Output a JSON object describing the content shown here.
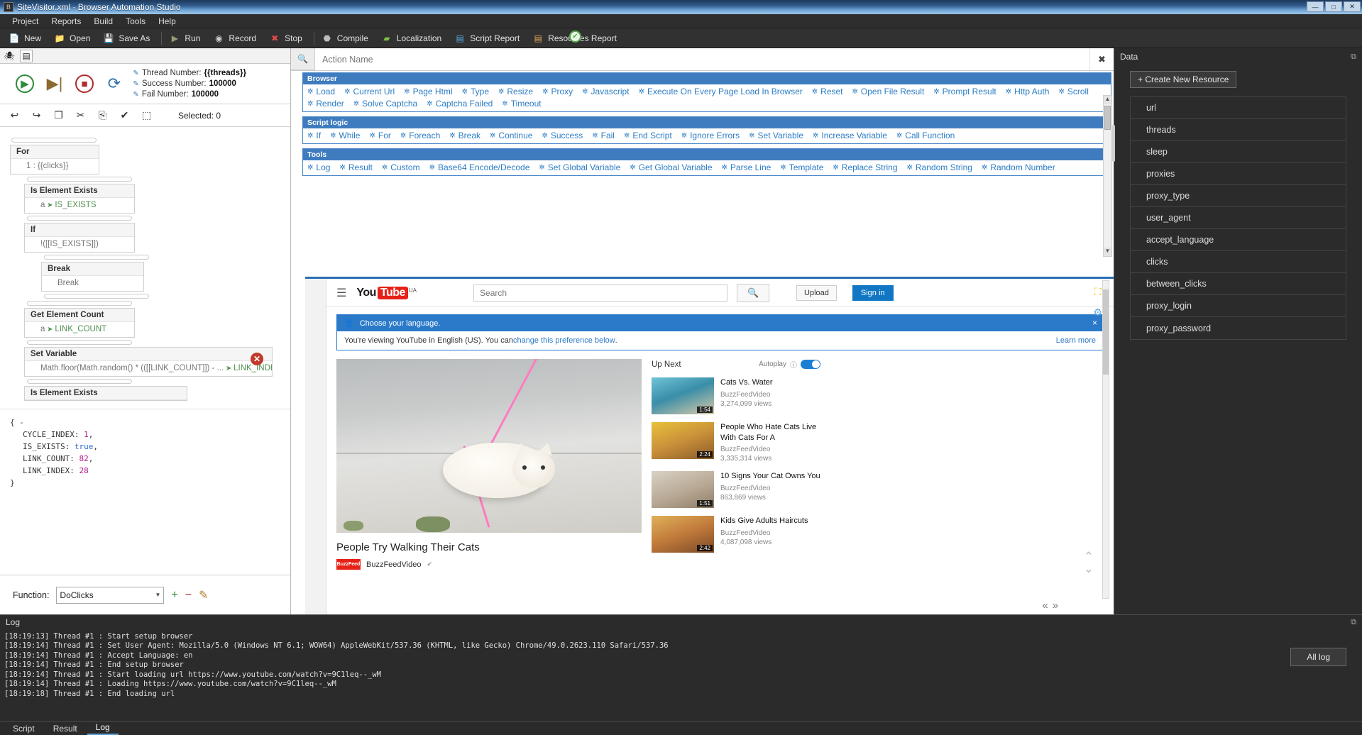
{
  "titlebar": {
    "title": "SiteVisitor.xml - Browser Automation Studio",
    "icon": "app-icon",
    "minimize": "—",
    "maximize": "□",
    "close": "✕"
  },
  "menu": {
    "items": [
      "Project",
      "Reports",
      "Build",
      "Tools",
      "Help"
    ]
  },
  "toolbar": {
    "items": [
      {
        "label": "New",
        "icon": "new-file-icon"
      },
      {
        "label": "Open",
        "icon": "open-folder-icon"
      },
      {
        "label": "Save As",
        "icon": "save-icon"
      },
      {
        "label": "Run",
        "icon": "play-icon"
      },
      {
        "label": "Record",
        "icon": "record-icon"
      },
      {
        "label": "Stop",
        "icon": "stop-icon"
      },
      {
        "label": "Compile",
        "icon": "compile-icon"
      },
      {
        "label": "Localization",
        "icon": "localization-icon"
      },
      {
        "label": "Script Report",
        "icon": "script-report-icon"
      },
      {
        "label": "Resources Report",
        "icon": "resources-report-icon"
      }
    ]
  },
  "left": {
    "tabs": [
      {
        "icon": "spider-icon"
      },
      {
        "icon": "list-icon"
      }
    ],
    "run_controls": [
      {
        "icon": "run-icon",
        "glyph": "▶",
        "color": "#2d8a3e"
      },
      {
        "icon": "step-icon",
        "glyph": "▶|",
        "color": "#8a6a2d"
      },
      {
        "icon": "stop-icon",
        "glyph": "■",
        "color": "#b02b2b"
      },
      {
        "icon": "restart-icon",
        "glyph": "⟳",
        "color": "#2b6fb0"
      }
    ],
    "run_info": [
      {
        "label": "Thread Number:",
        "value": "{{threads}}"
      },
      {
        "label": "Success Number:",
        "value": "100000"
      },
      {
        "label": "Fail Number:",
        "value": "100000"
      }
    ],
    "edit_icons": [
      "undo-icon",
      "redo-icon",
      "copy-icon",
      "cut-icon",
      "paste-icon",
      "check-icon",
      "select-all-icon"
    ],
    "selected_label": "Selected: 0",
    "tree": [
      {
        "level": 0,
        "title": "For",
        "body": "1 : {{clicks}}",
        "var": ""
      },
      {
        "level": 1,
        "title": "Is Element Exists",
        "body": "a",
        "var": "IS_EXISTS"
      },
      {
        "level": 1,
        "title": "If",
        "body": "!([[IS_EXISTS]])",
        "var": ""
      },
      {
        "level": 2,
        "title": "Break",
        "body": "Break",
        "var": ""
      },
      {
        "level": 1,
        "title": "Get Element Count",
        "body": "a",
        "var": "LINK_COUNT"
      },
      {
        "level": 1,
        "title": "Set Variable",
        "body": "Math.floor(Math.random() * (([[LINK_COUNT]]) - ...",
        "var": "LINK_INDEX"
      },
      {
        "level": 1,
        "title": "Is Element Exists",
        "body": "",
        "var": ""
      }
    ],
    "json_viewer": {
      "open": "{ -",
      "close": "}",
      "entries": [
        {
          "key": "CYCLE_INDEX:",
          "value": "1",
          "type": "num",
          "comma": ","
        },
        {
          "key": "IS_EXISTS:",
          "value": "true",
          "type": "bool",
          "comma": ","
        },
        {
          "key": "LINK_COUNT:",
          "value": "82",
          "type": "num",
          "comma": ","
        },
        {
          "key": "LINK_INDEX:",
          "value": "28",
          "type": "num",
          "comma": ""
        }
      ]
    },
    "function_bar": {
      "label": "Function:",
      "selected": "DoClicks",
      "add": "+",
      "remove": "−",
      "edit": "✎"
    }
  },
  "palette": {
    "search_placeholder": "Action Name",
    "search_value": "",
    "search_icon": "search-icon",
    "clear_icon": "clear-icon",
    "groups": [
      {
        "name": "Browser",
        "actions": [
          "Load",
          "Current Url",
          "Page Html",
          "Type",
          "Resize",
          "Proxy",
          "Javascript",
          "Execute On Every Page Load In Browser",
          "Reset",
          "Open File Result",
          "Prompt Result",
          "Http Auth",
          "Scroll",
          "Render",
          "Solve Captcha",
          "Captcha Failed",
          "Timeout"
        ]
      },
      {
        "name": "Script logic",
        "actions": [
          "If",
          "While",
          "For",
          "Foreach",
          "Break",
          "Continue",
          "Success",
          "Fail",
          "End Script",
          "Ignore Errors",
          "Set Variable",
          "Increase Variable",
          "Call Function"
        ]
      },
      {
        "name": "Tools",
        "actions": [
          "Log",
          "Result",
          "Custom",
          "Base64 Encode/Decode",
          "Set Global Variable",
          "Get Global Variable",
          "Parse Line",
          "Template",
          "Replace String",
          "Random String",
          "Random Number"
        ]
      }
    ]
  },
  "browser": {
    "header": {
      "menu_icon": "hamburger-icon",
      "logo_you": "You",
      "logo_tube": "Tube",
      "logo_country": "UA",
      "search_placeholder": "Search",
      "search_icon": "search-icon",
      "upload_label": "Upload",
      "signin_label": "Sign in"
    },
    "banner": {
      "icon": "person-language-icon",
      "title": "Choose your language.",
      "close": "×",
      "text_before": "You're viewing YouTube in English (US). You can ",
      "link": "change this preference below",
      "text_after": ".",
      "learn_more": "Learn more"
    },
    "video": {
      "title": "People Try Walking Their Cats",
      "channel_badge": "BuzzFeed",
      "channel": "BuzzFeedVideo",
      "verified_icon": "verified-icon"
    },
    "up_next": {
      "heading": "Up Next",
      "autoplay_label": "Autoplay",
      "info_icon": "info-icon",
      "toggle_on": true,
      "items": [
        {
          "title": "Cats Vs. Water",
          "channel": "BuzzFeedVideo",
          "views": "3,274,099 views",
          "duration": "1:54"
        },
        {
          "title": "People Who Hate Cats Live With Cats For A",
          "channel": "BuzzFeedVideo",
          "views": "3,335,314 views",
          "duration": "2:24"
        },
        {
          "title": "10 Signs Your Cat Owns You",
          "channel": "BuzzFeedVideo",
          "views": "863,869 views",
          "duration": "1:51"
        },
        {
          "title": "Kids Give Adults Haircuts",
          "channel": "BuzzFeedVideo",
          "views": "4,087,098 views",
          "duration": "2:42"
        }
      ]
    },
    "nav_prev": "«",
    "nav_next": "»",
    "scroll_up_icon": "chevron-up-icon",
    "scroll_down_icon": "chevron-down-icon",
    "tools": [
      {
        "icon": "maximize-tool-icon"
      },
      {
        "icon": "settings-tool-icon"
      }
    ]
  },
  "data_panel": {
    "title": "Data",
    "pin_icon": "pin-icon",
    "create_label": "+ Create New Resource",
    "resources": [
      "url",
      "threads",
      "sleep",
      "proxies",
      "proxy_type",
      "user_agent",
      "accept_language",
      "clicks",
      "between_clicks",
      "proxy_login",
      "proxy_password"
    ]
  },
  "log_panel": {
    "title": "Log",
    "collapse_icon": "collapse-icon",
    "all_log_label": "All log",
    "lines": [
      "[18:19:13] Thread #1 : Start setup browser",
      "[18:19:14] Thread #1 : Set User Agent: Mozilla/5.0 (Windows NT 6.1; WOW64) AppleWebKit/537.36 (KHTML, like Gecko) Chrome/49.0.2623.110 Safari/537.36",
      "[18:19:14] Thread #1 : Accept Language: en",
      "[18:19:14] Thread #1 : End setup browser",
      "[18:19:14] Thread #1 : Start loading url https://www.youtube.com/watch?v=9C1leq--_wM",
      "[18:19:14] Thread #1 : Loading https://www.youtube.com/watch?v=9C1leq--_wM",
      "[18:19:18] Thread #1 : End loading url"
    ]
  },
  "bottom_tabs": {
    "items": [
      "Script",
      "Result",
      "Log"
    ],
    "selected": "Log"
  }
}
